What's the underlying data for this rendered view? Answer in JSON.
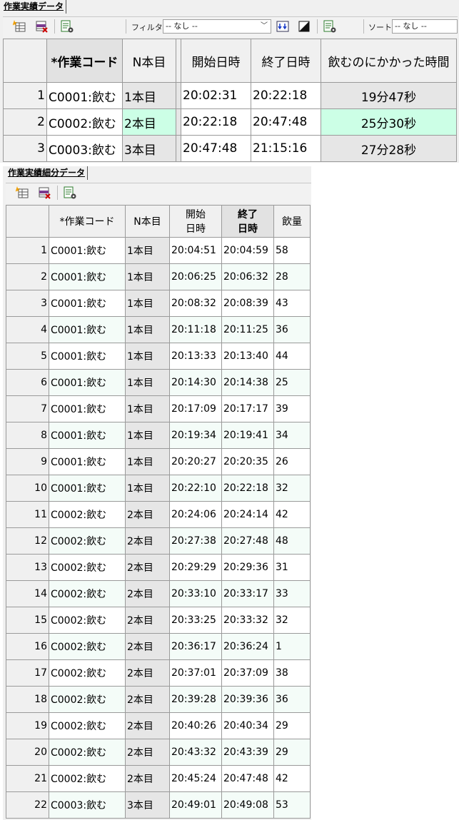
{
  "panel1": {
    "tab_label": "作業実績データ",
    "toolbar": {
      "filter_label": "フィルタ",
      "filter_value": "-- なし --",
      "sort_label": "ソート",
      "sort_value": "-- なし --"
    },
    "columns": [
      "*作業コード",
      "N本目",
      "開始日時",
      "終了日時",
      "飲むのにかかった時間"
    ],
    "rows": [
      {
        "no": "1",
        "code": "C0001:飲む",
        "n": "1本目",
        "start": "20:02:31",
        "end": "20:22:18",
        "dur": "19分47秒"
      },
      {
        "no": "2",
        "code": "C0002:飲む",
        "n": "2本目",
        "start": "20:22:18",
        "end": "20:47:48",
        "dur": "25分30秒"
      },
      {
        "no": "3",
        "code": "C0003:飲む",
        "n": "3本目",
        "start": "20:47:48",
        "end": "21:15:16",
        "dur": "27分28秒"
      }
    ]
  },
  "panel2": {
    "tab_label": "作業実績細分データ",
    "columns": {
      "code": "*作業コード",
      "n": "N本目",
      "start_1": "開始",
      "start_2": "日時",
      "end_1": "終了",
      "end_2": "日時",
      "amount": "飲量"
    },
    "rows": [
      {
        "no": "1",
        "code": "C0001:飲む",
        "n": "1本目",
        "start": "20:04:51",
        "end": "20:04:59",
        "amt": "58"
      },
      {
        "no": "2",
        "code": "C0001:飲む",
        "n": "1本目",
        "start": "20:06:25",
        "end": "20:06:32",
        "amt": "28"
      },
      {
        "no": "3",
        "code": "C0001:飲む",
        "n": "1本目",
        "start": "20:08:32",
        "end": "20:08:39",
        "amt": "43"
      },
      {
        "no": "4",
        "code": "C0001:飲む",
        "n": "1本目",
        "start": "20:11:18",
        "end": "20:11:25",
        "amt": "36"
      },
      {
        "no": "5",
        "code": "C0001:飲む",
        "n": "1本目",
        "start": "20:13:33",
        "end": "20:13:40",
        "amt": "44"
      },
      {
        "no": "6",
        "code": "C0001:飲む",
        "n": "1本目",
        "start": "20:14:30",
        "end": "20:14:38",
        "amt": "25"
      },
      {
        "no": "7",
        "code": "C0001:飲む",
        "n": "1本目",
        "start": "20:17:09",
        "end": "20:17:17",
        "amt": "39"
      },
      {
        "no": "8",
        "code": "C0001:飲む",
        "n": "1本目",
        "start": "20:19:34",
        "end": "20:19:41",
        "amt": "34"
      },
      {
        "no": "9",
        "code": "C0001:飲む",
        "n": "1本目",
        "start": "20:20:27",
        "end": "20:20:35",
        "amt": "26"
      },
      {
        "no": "10",
        "code": "C0001:飲む",
        "n": "1本目",
        "start": "20:22:10",
        "end": "20:22:18",
        "amt": "32"
      },
      {
        "no": "11",
        "code": "C0002:飲む",
        "n": "2本目",
        "start": "20:24:06",
        "end": "20:24:14",
        "amt": "42"
      },
      {
        "no": "12",
        "code": "C0002:飲む",
        "n": "2本目",
        "start": "20:27:38",
        "end": "20:27:48",
        "amt": "48"
      },
      {
        "no": "13",
        "code": "C0002:飲む",
        "n": "2本目",
        "start": "20:29:29",
        "end": "20:29:36",
        "amt": "31"
      },
      {
        "no": "14",
        "code": "C0002:飲む",
        "n": "2本目",
        "start": "20:33:10",
        "end": "20:33:17",
        "amt": "33"
      },
      {
        "no": "15",
        "code": "C0002:飲む",
        "n": "2本目",
        "start": "20:33:25",
        "end": "20:33:32",
        "amt": "32"
      },
      {
        "no": "16",
        "code": "C0002:飲む",
        "n": "2本目",
        "start": "20:36:17",
        "end": "20:36:24",
        "amt": "1"
      },
      {
        "no": "17",
        "code": "C0002:飲む",
        "n": "2本目",
        "start": "20:37:01",
        "end": "20:37:09",
        "amt": "38"
      },
      {
        "no": "18",
        "code": "C0002:飲む",
        "n": "2本目",
        "start": "20:39:28",
        "end": "20:39:36",
        "amt": "36"
      },
      {
        "no": "19",
        "code": "C0002:飲む",
        "n": "2本目",
        "start": "20:40:26",
        "end": "20:40:34",
        "amt": "29"
      },
      {
        "no": "20",
        "code": "C0002:飲む",
        "n": "2本目",
        "start": "20:43:32",
        "end": "20:43:39",
        "amt": "29"
      },
      {
        "no": "21",
        "code": "C0002:飲む",
        "n": "2本目",
        "start": "20:45:24",
        "end": "20:47:48",
        "amt": "42"
      },
      {
        "no": "22",
        "code": "C0003:飲む",
        "n": "3本目",
        "start": "20:49:01",
        "end": "20:49:08",
        "amt": "53"
      }
    ]
  },
  "colors": {
    "selected_row": "#ccffe6",
    "zebra_row": "#f4fcf8",
    "header_bg": "#f0f0f0",
    "key_column": "#e6e6e6"
  },
  "icons": [
    "add-row-icon",
    "delete-row-icon",
    "settings-icon",
    "filter-apply-icon",
    "contrast-icon",
    "sort-settings-icon"
  ]
}
